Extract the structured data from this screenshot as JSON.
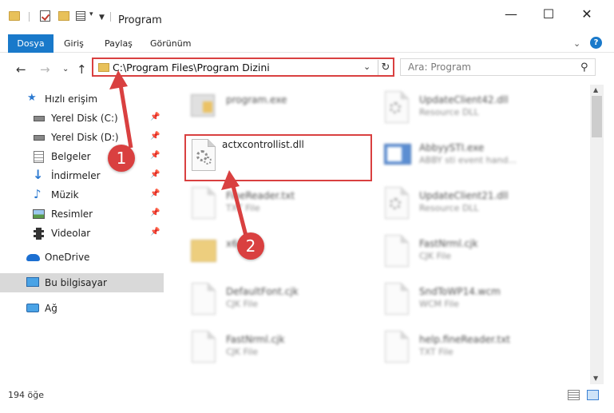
{
  "window": {
    "title": "Program"
  },
  "ribbon": {
    "tabs": [
      "Dosya",
      "Giriş",
      "Paylaş",
      "Görünüm"
    ],
    "help_label": "?"
  },
  "address": {
    "path": "C:\\Program Files\\Program Dizini"
  },
  "search": {
    "placeholder": "Ara: Program"
  },
  "sidebar": {
    "items": [
      {
        "label": "Hızlı erişim",
        "icon": "star-icon",
        "pinned": false
      },
      {
        "label": "Yerel Disk (C:)",
        "icon": "drive-icon",
        "pinned": true
      },
      {
        "label": "Yerel Disk (D:)",
        "icon": "drive-icon",
        "pinned": true
      },
      {
        "label": "Belgeler",
        "icon": "documents-icon",
        "pinned": true
      },
      {
        "label": "İndirmeler",
        "icon": "download-icon",
        "pinned": true
      },
      {
        "label": "Müzik",
        "icon": "music-icon",
        "pinned": true
      },
      {
        "label": "Resimler",
        "icon": "pictures-icon",
        "pinned": true
      },
      {
        "label": "Videolar",
        "icon": "video-icon",
        "pinned": true
      },
      {
        "label": "OneDrive",
        "icon": "cloud-icon",
        "pinned": false
      },
      {
        "label": "Bu bilgisayar",
        "icon": "computer-icon",
        "pinned": false,
        "selected": true
      },
      {
        "label": "Ağ",
        "icon": "network-icon",
        "pinned": false
      }
    ]
  },
  "files": {
    "left": [
      {
        "name": "program.exe",
        "desc": "",
        "icon": "exe-icon"
      },
      {
        "name": "actxcontrollist.dll",
        "desc": "",
        "icon": "dll-icon"
      },
      {
        "name": "FineReader.txt",
        "desc": "TXT File",
        "icon": "text-icon"
      },
      {
        "name": "x64",
        "desc": "",
        "icon": "folder-icon"
      },
      {
        "name": "DefaultFont.cjk",
        "desc": "CJK File",
        "icon": "file-icon"
      },
      {
        "name": "FastNrml.cjk",
        "desc": "CJK File",
        "icon": "file-icon"
      }
    ],
    "right": [
      {
        "name": "UpdateClient42.dll",
        "desc": "Resource DLL",
        "icon": "dll-icon"
      },
      {
        "name": "AbbyySTI.exe",
        "desc": "ABBY sti event hand...",
        "icon": "app-icon"
      },
      {
        "name": "UpdateClient21.dll",
        "desc": "Resource DLL",
        "icon": "dll-icon"
      },
      {
        "name": "FastNrml.cjk",
        "desc": "CJK File",
        "icon": "file-icon"
      },
      {
        "name": "SndToWP14.wcm",
        "desc": "WCM File",
        "icon": "file-icon"
      },
      {
        "name": "help.fineReader.txt",
        "desc": "TXT File",
        "icon": "text-icon"
      }
    ]
  },
  "annotations": {
    "step1": "1",
    "step2": "2",
    "accent": "#d94040"
  },
  "status": {
    "count": "194 öğe"
  }
}
